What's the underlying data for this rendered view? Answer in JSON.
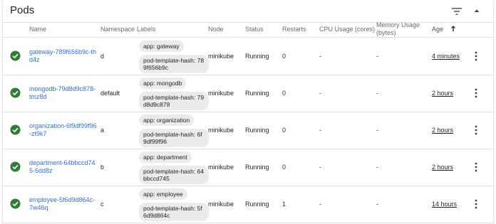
{
  "panel": {
    "title": "Pods"
  },
  "columns": {
    "name": "Name",
    "namespace": "Namespace",
    "labels": "Labels",
    "node": "Node",
    "status": "Status",
    "restarts": "Restarts",
    "cpu": "CPU Usage (cores)",
    "memory": "Memory Usage (bytes)",
    "age": "Age"
  },
  "status_color": "#2e7d32",
  "link_color": "#326de6",
  "pods": [
    {
      "name": "gateway-789f656b9c-thd4z",
      "namespace": "d",
      "label_app": "app: gateway",
      "label_hash": "pod-template-hash: 789f656b9c",
      "node": "minikube",
      "status": "Running",
      "restarts": "0",
      "cpu": "-",
      "memory": "-",
      "age": "4 minutes"
    },
    {
      "name": "mongodb-79d8d9c878-tmz8d",
      "namespace": "default",
      "label_app": "app: mongodb",
      "label_hash": "pod-template-hash: 79d8d9c878",
      "node": "minikube",
      "status": "Running",
      "restarts": "0",
      "cpu": "-",
      "memory": "-",
      "age": "2 hours"
    },
    {
      "name": "organization-6f9df99f96-zt9k7",
      "namespace": "a",
      "label_app": "app: organization",
      "label_hash": "pod-template-hash: 6f9df99f96",
      "node": "minikube",
      "status": "Running",
      "restarts": "0",
      "cpu": "-",
      "memory": "-",
      "age": "2 hours"
    },
    {
      "name": "department-64bbccd745-5dd8z",
      "namespace": "b",
      "label_app": "app: department",
      "label_hash": "pod-template-hash: 64bbccd745",
      "node": "minikube",
      "status": "Running",
      "restarts": "0",
      "cpu": "-",
      "memory": "-",
      "age": "2 hours"
    },
    {
      "name": "employee-5f6d9d864c-7w46q",
      "namespace": "c",
      "label_app": "app: employee",
      "label_hash": "pod-template-hash: 5f6d9d864c",
      "node": "minikube",
      "status": "Running",
      "restarts": "1",
      "cpu": "-",
      "memory": "-",
      "age": "14 hours"
    }
  ]
}
